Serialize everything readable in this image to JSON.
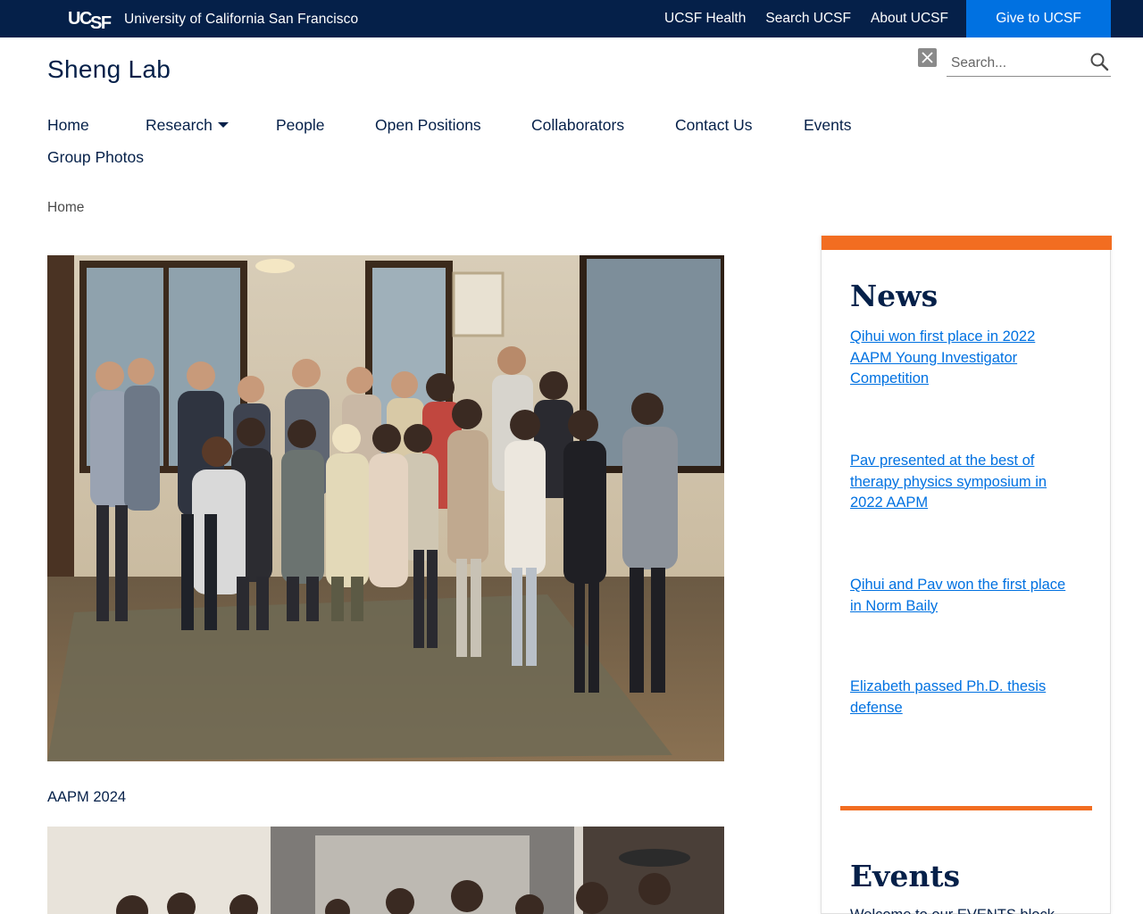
{
  "topbar": {
    "logo_alt": "UCSF",
    "university_name": "University of California San Francisco",
    "links": [
      "UCSF Health",
      "Search UCSF",
      "About UCSF"
    ],
    "give_label": "Give to UCSF",
    "colors": {
      "background": "#052049",
      "give_button": "#0071e1"
    }
  },
  "header": {
    "site_title": "Sheng Lab",
    "social_icon": "x-icon",
    "search": {
      "placeholder": "Search...",
      "icon": "search-icon"
    }
  },
  "nav": {
    "items": [
      "Home",
      "Research",
      "People",
      "Open Positions",
      "Collaborators",
      "Contact Us",
      "Events",
      "Group Photos"
    ],
    "dropdown_icon": "caret-down-icon"
  },
  "breadcrumb": [
    "Home"
  ],
  "main": {
    "photos": [
      {
        "caption": "AAPM 2024"
      },
      {
        "caption": ""
      }
    ]
  },
  "sidebar": {
    "accent_color": "#f26d21",
    "news": {
      "heading": "News",
      "items": [
        "Qihui won first place in 2022 AAPM Young Investigator Competition",
        "Pav presented at the best of therapy physics symposium in 2022 AAPM",
        "Qihui and Pav won the first place in Norm Baily",
        "Elizabeth passed Ph.D. thesis defense"
      ]
    },
    "events": {
      "heading": "Events",
      "text": "Welcome to our EVENTS block"
    }
  }
}
